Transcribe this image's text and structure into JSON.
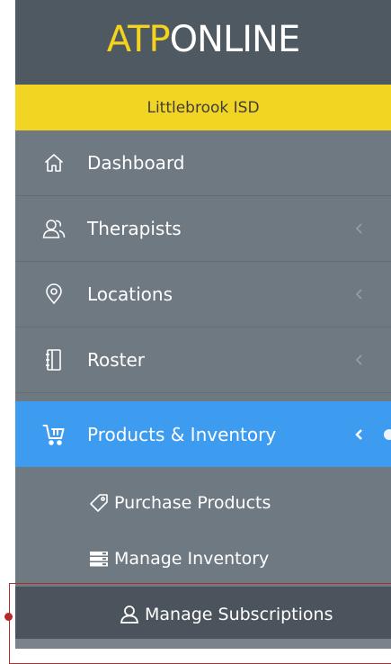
{
  "brand": {
    "logo_part1": "ATP",
    "logo_part2": "ONLINE",
    "organization": "Littlebrook ISD"
  },
  "nav": {
    "items": [
      {
        "label": "Dashboard",
        "icon": "home-icon"
      },
      {
        "label": "Therapists",
        "icon": "people-icon",
        "has_submenu": true
      },
      {
        "label": "Locations",
        "icon": "location-pin-icon",
        "has_submenu": true
      },
      {
        "label": "Roster",
        "icon": "notebook-icon",
        "has_submenu": true
      },
      {
        "label": "Products & Inventory",
        "icon": "cart-icon",
        "has_submenu": true,
        "active": true
      }
    ],
    "subitems": [
      {
        "label": "Purchase Products",
        "icon": "tag-icon"
      },
      {
        "label": "Manage Inventory",
        "icon": "server-icon"
      },
      {
        "label": "Manage Subscriptions",
        "icon": "user-icon",
        "selected": true
      }
    ]
  },
  "colors": {
    "sidebar_bg": "#6f7982",
    "logo_bg": "#4e5962",
    "brand_yellow": "#f2d423",
    "active_blue": "#3d9bf0",
    "selected_bg": "#4b545c",
    "highlight_red": "#b52a2a"
  }
}
